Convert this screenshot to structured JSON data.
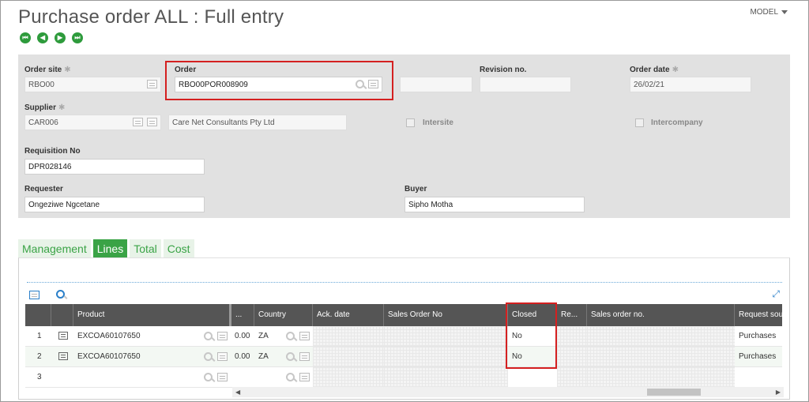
{
  "header": {
    "title": "Purchase order ALL : Full entry",
    "model_label": "MODEL",
    "nav_buttons": [
      "first",
      "previous",
      "next",
      "last"
    ]
  },
  "form": {
    "order_site": {
      "label": "Order site",
      "value": "RBO00"
    },
    "order": {
      "label": "Order",
      "value": "RBO00POR008909"
    },
    "revision_no": {
      "label": "Revision no.",
      "value": ""
    },
    "order_date": {
      "label": "Order date",
      "value": "26/02/21"
    },
    "supplier": {
      "label": "Supplier",
      "value": "CAR006",
      "name": "Care Net Consultants Pty Ltd"
    },
    "intersite": {
      "label": "Intersite",
      "checked": false
    },
    "intercompany": {
      "label": "Intercompany",
      "checked": false
    },
    "requisition_no": {
      "label": "Requisition No",
      "value": "DPR028146"
    },
    "requester": {
      "label": "Requester",
      "value": "Ongeziwe Ngcetane"
    },
    "buyer": {
      "label": "Buyer",
      "value": "Sipho Motha"
    }
  },
  "tabs": [
    {
      "label": "Management",
      "active": false
    },
    {
      "label": "Lines",
      "active": true
    },
    {
      "label": "Total",
      "active": false
    },
    {
      "label": "Cost",
      "active": false
    }
  ],
  "grid": {
    "columns": [
      "Product",
      "...",
      "Country",
      "Ack. date",
      "Sales Order No",
      "Closed",
      "Re...",
      "Sales order no.",
      "Request sou"
    ],
    "rows": [
      {
        "num": "1",
        "product": "EXCOA60107650",
        "qty": "0.00",
        "country": "ZA",
        "closed": "No",
        "request_source": "Purchases"
      },
      {
        "num": "2",
        "product": "EXCOA60107650",
        "qty": "0.00",
        "country": "ZA",
        "closed": "No",
        "request_source": "Purchases"
      },
      {
        "num": "3",
        "product": "",
        "qty": "",
        "country": "",
        "closed": "",
        "request_source": ""
      }
    ]
  },
  "colors": {
    "accent_green": "#3aa346",
    "highlight_red": "#d42020",
    "grid_header": "#555555"
  }
}
